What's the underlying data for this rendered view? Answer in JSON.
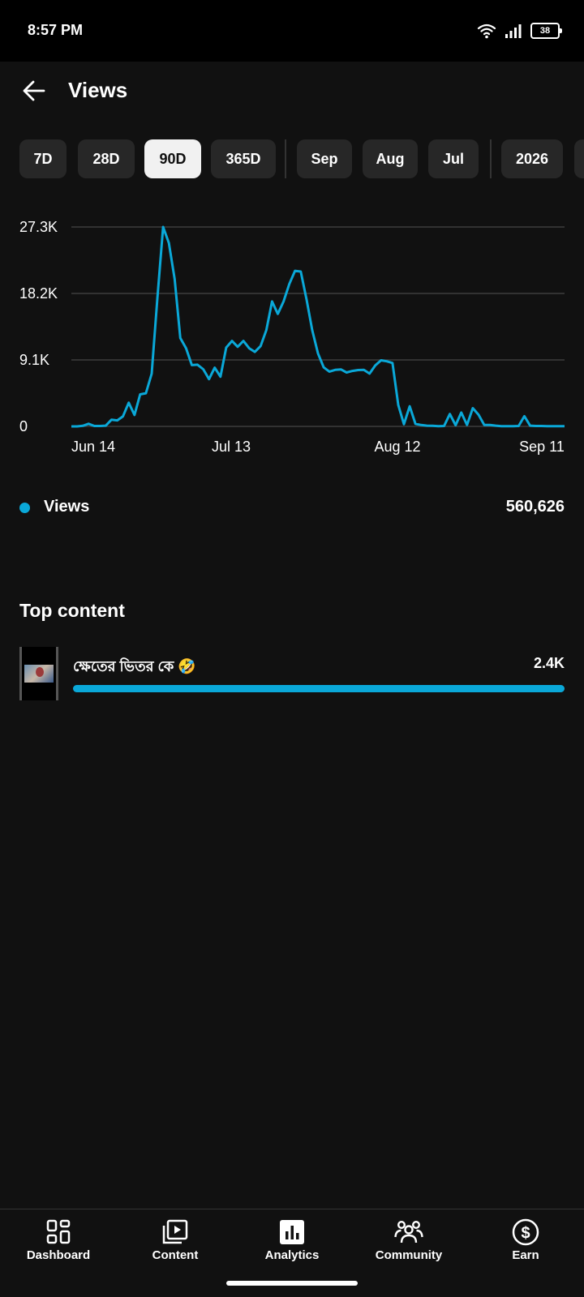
{
  "status_bar": {
    "time": "8:57 PM",
    "battery": "38"
  },
  "header": {
    "title": "Views"
  },
  "chips": [
    {
      "label": "7D",
      "active": false
    },
    {
      "label": "28D",
      "active": false
    },
    {
      "label": "90D",
      "active": true
    },
    {
      "label": "365D",
      "active": false
    },
    {
      "label": "Sep",
      "active": false
    },
    {
      "label": "Aug",
      "active": false
    },
    {
      "label": "Jul",
      "active": false
    },
    {
      "label": "2026",
      "active": false
    }
  ],
  "chart_data": {
    "type": "line",
    "series": [
      {
        "color": "#0aa8d8",
        "values": [
          0,
          0,
          80,
          350,
          60,
          60,
          100,
          920,
          820,
          1380,
          3240,
          1560,
          4380,
          4540,
          7210,
          17500,
          27300,
          25100,
          20200,
          12100,
          10700,
          8390,
          8450,
          7820,
          6470,
          8030,
          6800,
          10800,
          11700,
          10900,
          11700,
          10700,
          10200,
          11000,
          13200,
          17100,
          15400,
          17100,
          19500,
          21300,
          21200,
          17400,
          13200,
          10000,
          8080,
          7500,
          7740,
          7800,
          7380,
          7590,
          7710,
          7730,
          7230,
          8350,
          9050,
          8910,
          8680,
          2930,
          300,
          2750,
          340,
          190,
          100,
          80,
          30,
          50,
          1700,
          150,
          1900,
          200,
          2500,
          1600,
          200,
          200,
          100,
          30,
          30,
          30,
          50,
          1400,
          100,
          50,
          50,
          30,
          30,
          30,
          30
        ]
      }
    ],
    "x_ticks": [
      "Jun 14",
      "Jul 13",
      "Aug 12",
      "Sep 11"
    ],
    "y_ticks": [
      "27.3K",
      "18.2K",
      "9.1K",
      "0"
    ],
    "ylim": [
      0,
      27300
    ],
    "grid": true
  },
  "legend": {
    "label": "Views",
    "total": "560,626",
    "color": "#0aa8d8"
  },
  "top_content": {
    "title": "Top content",
    "items": [
      {
        "title": "ক্ষেতের ভিতর কে 🤣",
        "views": "2.4K",
        "bar_fraction": 1.0
      }
    ]
  },
  "bottom_nav": [
    {
      "label": "Dashboard",
      "icon": "dashboard-icon"
    },
    {
      "label": "Content",
      "icon": "content-icon"
    },
    {
      "label": "Analytics",
      "icon": "analytics-icon",
      "active": true
    },
    {
      "label": "Community",
      "icon": "community-icon"
    },
    {
      "label": "Earn",
      "icon": "earn-icon"
    }
  ]
}
